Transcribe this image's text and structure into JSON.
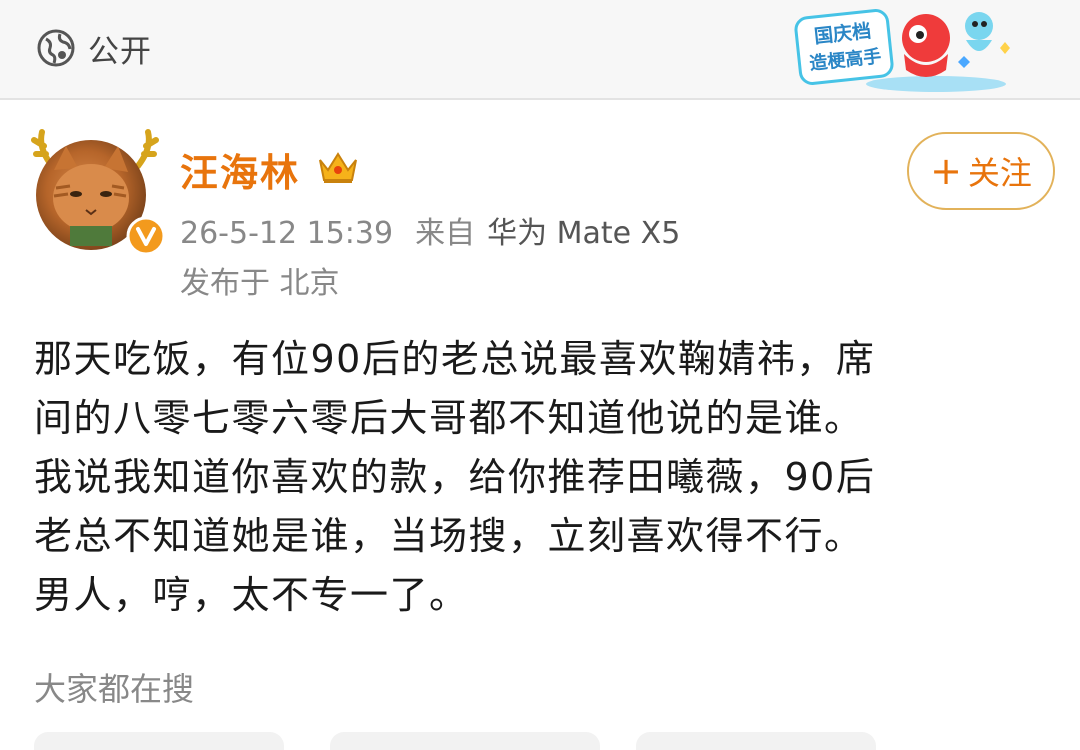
{
  "header": {
    "visibility_label": "公开",
    "promo_badge_text_1": "国庆档",
    "promo_badge_text_2": "造梗高手"
  },
  "author": {
    "name": "汪海林",
    "follow_label": "关注",
    "timestamp": "26-5-12 15:39",
    "source_prefix": "来自",
    "device": "华为 Mate X5",
    "location": "发布于 北京"
  },
  "post": {
    "lines": [
      "那天吃饭，有位90后的老总说最喜欢鞠婧祎，席",
      "间的八零七零六零后大哥都不知道他说的是谁。",
      "我说我知道你喜欢的款，给你推荐田曦薇，90后",
      "老总不知道她是谁，当场搜，立刻喜欢得不行。",
      "男人，哼，太不专一了。"
    ]
  },
  "trending": {
    "label": "大家都在搜"
  },
  "colors": {
    "accent_orange": "#e8740c",
    "follow_border": "#e2b25a",
    "meta_gray": "#888888"
  },
  "icons": [
    "globe-icon",
    "crown-icon",
    "verified-icon",
    "plus-icon",
    "antler-icon"
  ]
}
